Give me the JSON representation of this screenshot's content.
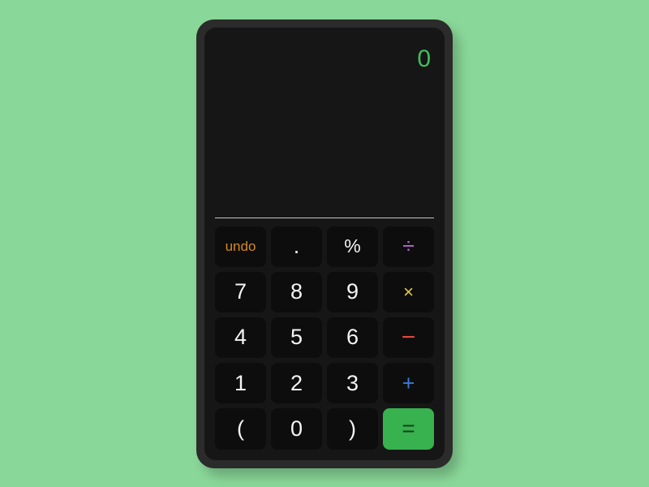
{
  "display": {
    "value": "0"
  },
  "keys": {
    "undo": "undo",
    "dot": ".",
    "percent": "%",
    "divide": "÷",
    "seven": "7",
    "eight": "8",
    "nine": "9",
    "multiply": "×",
    "four": "4",
    "five": "5",
    "six": "6",
    "minus": "−",
    "one": "1",
    "two": "2",
    "three": "3",
    "plus": "+",
    "open_paren": "(",
    "zero": "0",
    "close_paren": ")",
    "equals": "="
  },
  "colors": {
    "background": "#8ad899",
    "chassis": "#2b2b2b",
    "panel": "#161616",
    "key": "#0d0d0d",
    "display_text": "#3fbf5a",
    "undo": "#d68a1e",
    "divide": "#b569d1",
    "multiply": "#e4cf3e",
    "minus": "#e04a3f",
    "plus": "#3a78d6",
    "equals_bg": "#38b14f"
  }
}
